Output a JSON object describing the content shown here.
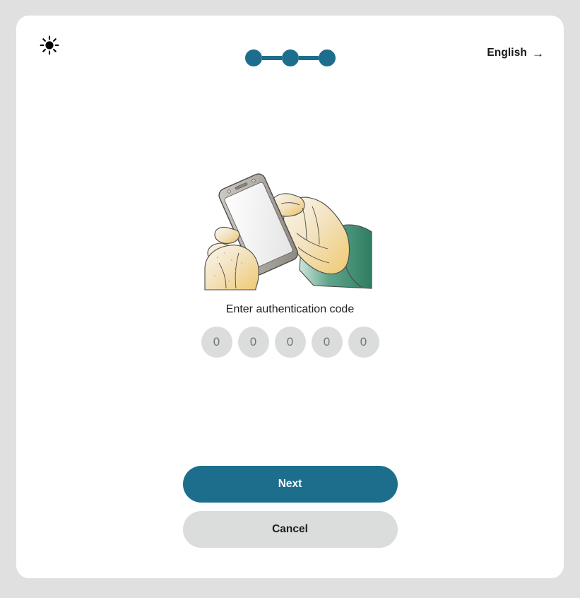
{
  "page": {
    "background_color": "#e0e0e0",
    "card_background": "#ffffff",
    "accent_color": "#1d6e8c",
    "muted_color": "#dbdcdc"
  },
  "header": {
    "brightness_icon": "sun-icon",
    "language": {
      "label": "English",
      "arrow": "→",
      "icon": "arrow-right-icon"
    },
    "stepper": {
      "total_steps": 3,
      "steps": [
        {
          "index": 1,
          "state": "complete"
        },
        {
          "index": 2,
          "state": "complete"
        },
        {
          "index": 3,
          "state": "current"
        }
      ]
    }
  },
  "main": {
    "illustration": {
      "name": "hand-holding-phone-illustration",
      "description": "Watercolor illustration of two hands holding a smartphone"
    },
    "prompt_label": "Enter authentication code",
    "code_entry": {
      "length": 5,
      "cells": [
        {
          "value": "",
          "placeholder": "0"
        },
        {
          "value": "",
          "placeholder": "0"
        },
        {
          "value": "",
          "placeholder": "0"
        },
        {
          "value": "",
          "placeholder": "0"
        },
        {
          "value": "",
          "placeholder": "0"
        }
      ]
    }
  },
  "actions": {
    "next_label": "Next",
    "cancel_label": "Cancel"
  }
}
